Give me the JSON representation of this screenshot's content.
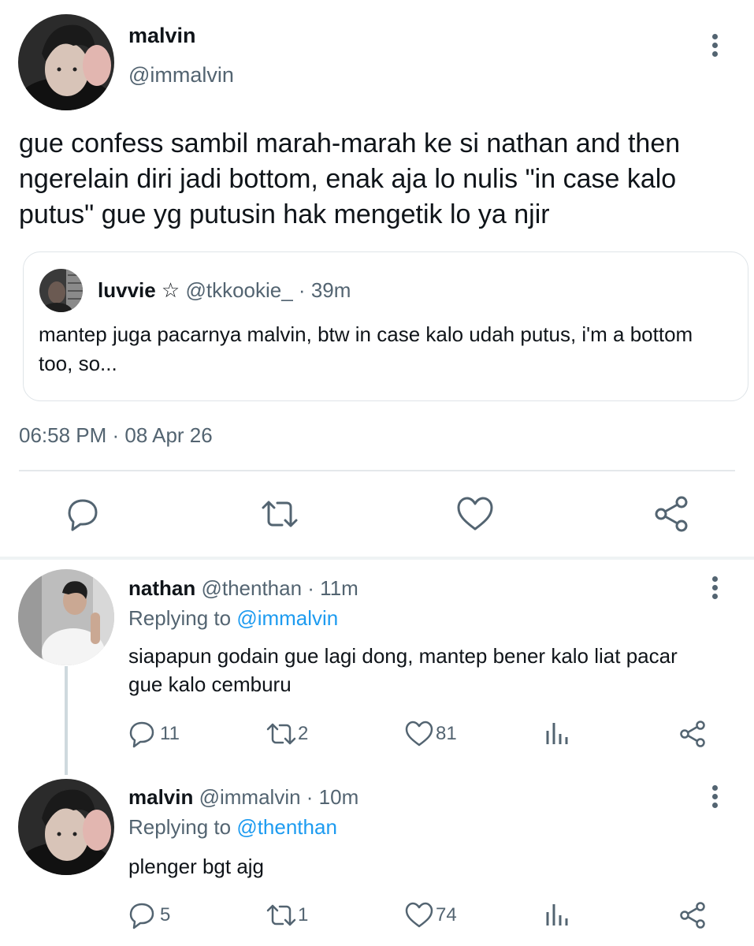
{
  "main_tweet": {
    "author_name": "malvin",
    "author_handle": "@immalvin",
    "text": "gue confess sambil marah-marah ke si nathan and then ngerelain diri jadi bottom, enak aja lo nulis \"in case kalo putus\" gue yg putusin hak mengetik lo ya njir",
    "timestamp": "06:58 PM · 08 Apr 26",
    "quote": {
      "author_name": "luvvie ☆",
      "meta": " @tkkookie_ · 39m",
      "text": "mantep juga pacarnya malvin, btw in case kalo udah putus, i'm a bottom too, so..."
    },
    "actions": [
      "reply-icon",
      "retweet-icon",
      "like-icon",
      "share-icon"
    ]
  },
  "replies": [
    {
      "author_name": "nathan",
      "meta": " @thenthan · 11m",
      "replying_prefix": "Replying to ",
      "replying_to": "@immalvin",
      "text": "siapapun godain gue lagi dong, mantep bener kalo liat pacar gue kalo cemburu",
      "reply_count": "11",
      "retweet_count": "2",
      "like_count": "81"
    },
    {
      "author_name": "malvin",
      "meta": " @immalvin · 10m",
      "replying_prefix": "Replying to ",
      "replying_to": "@thenthan",
      "text": "plenger bgt ajg",
      "reply_count": "5",
      "retweet_count": "1",
      "like_count": "74"
    }
  ],
  "colors": {
    "text": "#0f1419",
    "secondary": "#536471",
    "link": "#1d9bf0",
    "divider": "#e4e8eb"
  }
}
